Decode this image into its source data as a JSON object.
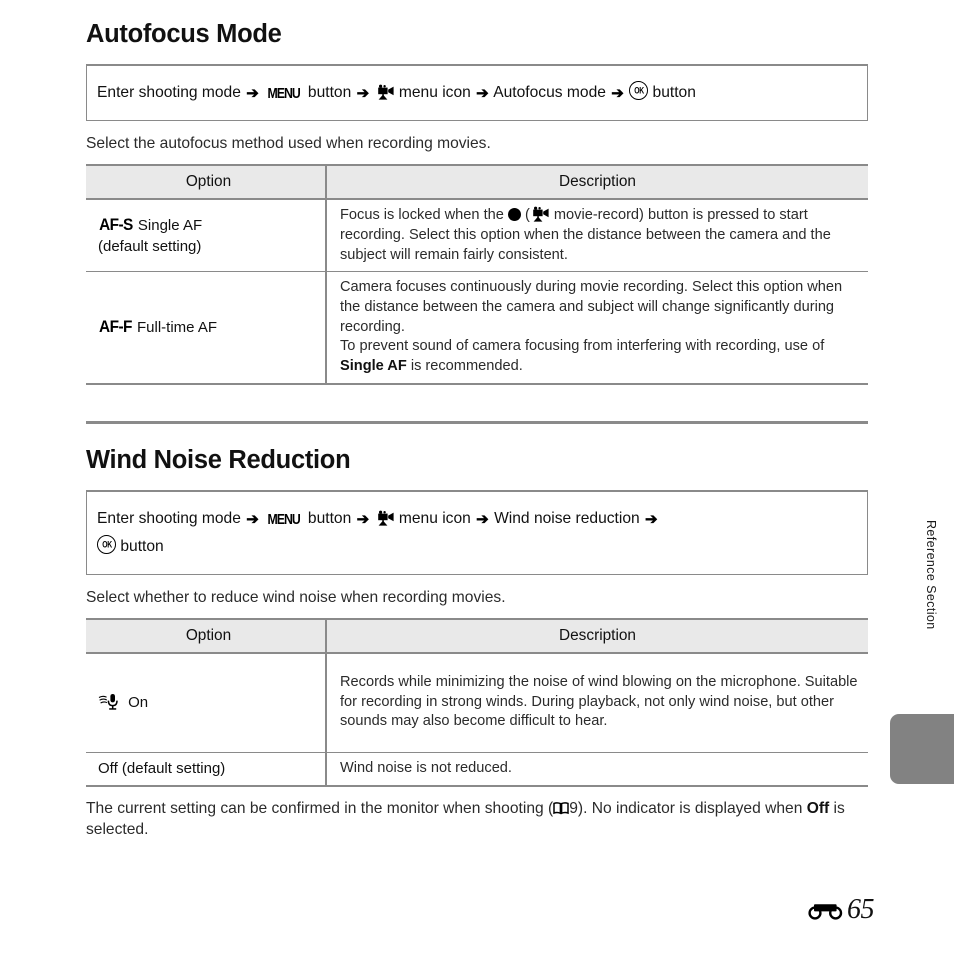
{
  "page": {
    "folio_number": "65",
    "folio_icon": "reference-section-icon",
    "side_tab_label": "Reference Section"
  },
  "sections": [
    {
      "id": "autofocus-mode",
      "title": "Autofocus Mode",
      "path": {
        "prefix": "Enter shooting mode",
        "arrow": "➔",
        "menu_icon_label": "MENU",
        "menu_button_text": "button",
        "movie_icon": "movie-camera-icon",
        "movie_menu_text": "menu icon",
        "item_text": "Autofocus mode",
        "ok_icon": "ok-button-icon",
        "ok_button_text": "button"
      },
      "lead": "Select the autofocus method used when recording movies.",
      "table": {
        "headers": [
          "Option",
          "Description"
        ],
        "rows": [
          {
            "code": "AF-S",
            "name": "Single AF",
            "sub": "(default setting)",
            "description_parts": [
              {
                "segments": [
                  {
                    "type": "text",
                    "text": "Focus is locked when the "
                  },
                  {
                    "type": "icon",
                    "icon": "record-dot-icon"
                  },
                  {
                    "type": "text",
                    "text": " ("
                  },
                  {
                    "type": "icon",
                    "icon": "movie-camera-icon"
                  },
                  {
                    "type": "text",
                    "text": " movie-record) button is pressed to start recording. Select this option when the distance between the camera and the subject will remain fairly consistent."
                  }
                ]
              }
            ]
          },
          {
            "code": "AF-F",
            "name": "Full-time AF",
            "sub": "",
            "description_parts": [
              {
                "segments": [
                  {
                    "type": "text",
                    "text": "Camera focuses continuously during movie recording. Select this option when the distance between the camera and subject will change significantly during recording."
                  }
                ]
              },
              {
                "segments": [
                  {
                    "type": "text",
                    "text": "To prevent sound of camera focusing from interfering with recording, use of "
                  },
                  {
                    "type": "bold",
                    "text": "Single AF"
                  },
                  {
                    "type": "text",
                    "text": " is recommended."
                  }
                ]
              }
            ]
          }
        ]
      }
    },
    {
      "id": "wind-noise-reduction",
      "title": "Wind Noise Reduction",
      "path": {
        "prefix": "Enter shooting mode",
        "arrow": "➔",
        "menu_icon_label": "MENU",
        "menu_button_text": "button",
        "movie_icon": "movie-camera-icon",
        "movie_menu_text": "menu icon",
        "item_text": "Wind noise reduction",
        "ok_icon": "ok-button-icon",
        "ok_button_text": "button"
      },
      "lead": "Select whether to reduce wind noise when recording movies.",
      "table": {
        "headers": [
          "Option",
          "Description"
        ],
        "rows": [
          {
            "icon": "wind-noise-mic-icon",
            "name": "On",
            "sub": "",
            "description_parts": [
              {
                "segments": [
                  {
                    "type": "text",
                    "text": "Records while minimizing the noise of wind blowing on the microphone. Suitable for recording in strong winds. During playback, not only wind noise, but other sounds may also become difficult to hear."
                  }
                ]
              }
            ]
          },
          {
            "icon": "",
            "name": "Off (default setting)",
            "sub": "",
            "description_parts": [
              {
                "segments": [
                  {
                    "type": "text",
                    "text": "Wind noise is not reduced."
                  }
                ]
              }
            ]
          }
        ]
      },
      "footnote": {
        "segments": [
          {
            "type": "text",
            "text": "The current setting can be confirmed in the monitor when shooting ("
          },
          {
            "type": "icon",
            "icon": "book-icon"
          },
          {
            "type": "text",
            "text": "9). No indicator is displayed when "
          },
          {
            "type": "bold",
            "text": "Off"
          },
          {
            "type": "text",
            "text": " is selected."
          }
        ]
      }
    }
  ]
}
